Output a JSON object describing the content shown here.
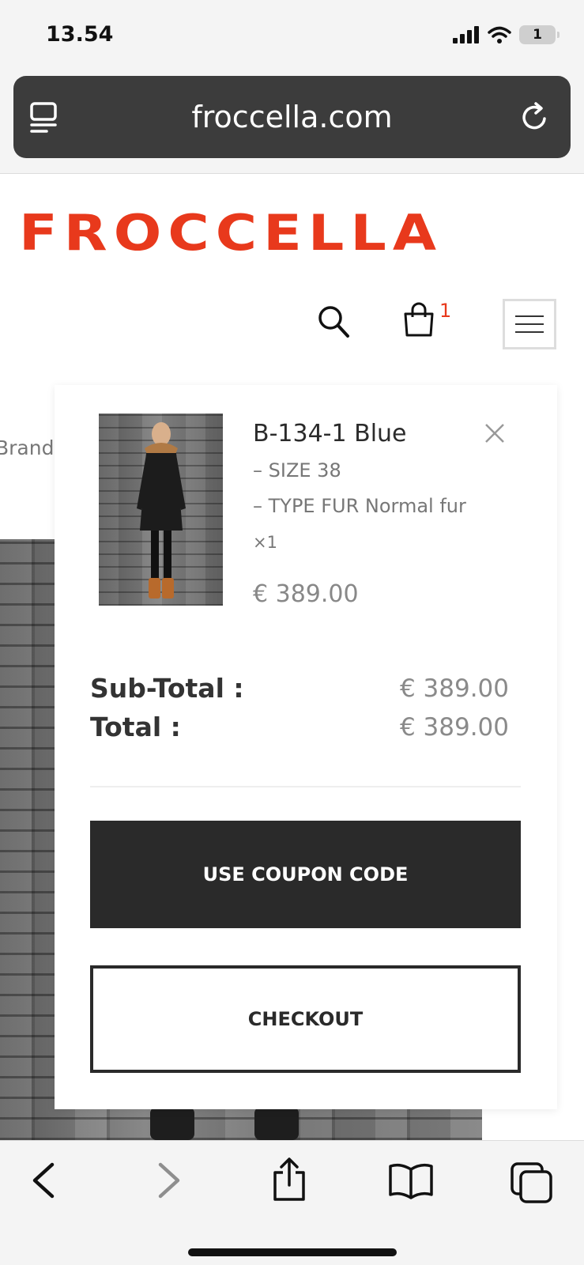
{
  "status_bar": {
    "time": "13.54",
    "battery": "1"
  },
  "browser": {
    "url": "froccella.com"
  },
  "site": {
    "logo": "FROCCELLA",
    "cart_count": "1",
    "brand_fragment": "Brand"
  },
  "cart": {
    "item": {
      "name": "B-134-1 Blue",
      "attributes": [
        "– SIZE 38",
        "– TYPE FUR Normal fur"
      ],
      "quantity": "×1",
      "price": "€ 389.00"
    },
    "subtotal_label": "Sub-Total :",
    "subtotal_value": "€ 389.00",
    "total_label": "Total :",
    "total_value": "€ 389.00",
    "coupon_button": "USE COUPON CODE",
    "checkout_button": "CHECKOUT"
  },
  "colors": {
    "brand": "#e8391c",
    "dark": "#2a2a2a",
    "url_bar": "#3c3c3c"
  },
  "icons": [
    "reader-icon",
    "reload-icon",
    "search-icon",
    "shopping-bag-icon",
    "hamburger-menu-icon",
    "close-icon",
    "back-arrow-icon",
    "forward-arrow-icon",
    "share-icon",
    "bookmarks-icon",
    "tabs-icon"
  ]
}
